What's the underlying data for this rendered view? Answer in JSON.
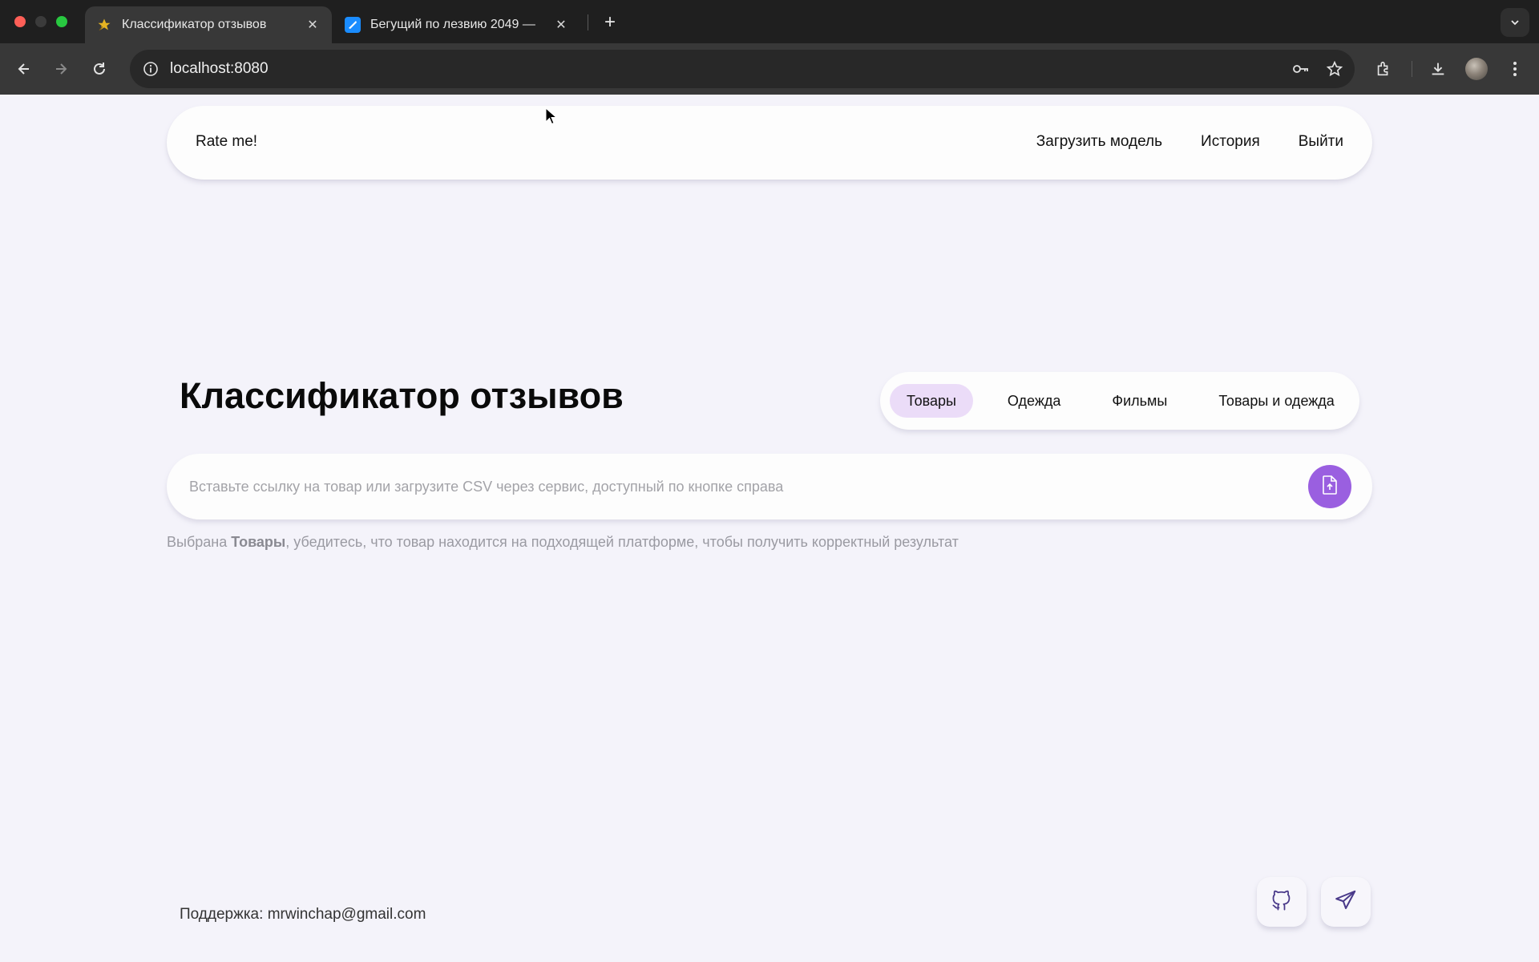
{
  "browser": {
    "tabs": [
      {
        "title": "Классификатор отзывов",
        "active": true
      },
      {
        "title": "Бегущий по лезвию 2049 —",
        "active": false
      }
    ],
    "url": "localhost:8080"
  },
  "header": {
    "logo": "Rate me!",
    "nav": {
      "upload_model": "Загрузить модель",
      "history": "История",
      "logout": "Выйти"
    }
  },
  "main": {
    "title": "Классификатор отзывов",
    "categories": [
      "Товары",
      "Одежда",
      "Фильмы",
      "Товары и одежда"
    ],
    "selected_category": "Товары",
    "search_placeholder": "Вставьте ссылку на товар или загрузите CSV через сервис, доступный по кнопке справа",
    "hint": {
      "prefix": "Выбрана ",
      "category": "Товары",
      "suffix": ", убедитесь, что товар находится на подходящей платформе, чтобы получить корректный результат"
    }
  },
  "footer": {
    "support_label": "Поддержка:",
    "support_email": "mrwinchap@gmail.com"
  },
  "colors": {
    "accent": "#9a5fe0",
    "active_category_bg": "#ebdcf8",
    "page_bg": "#f4f3fa"
  },
  "icons": [
    "star-favicon",
    "site-favicon",
    "close-icon",
    "plus-icon",
    "chevron-down-icon",
    "back-icon",
    "forward-icon",
    "reload-icon",
    "info-icon",
    "key-icon",
    "star-icon",
    "extensions-icon",
    "download-icon",
    "more-icon",
    "file-upload-icon",
    "github-icon",
    "telegram-icon"
  ]
}
